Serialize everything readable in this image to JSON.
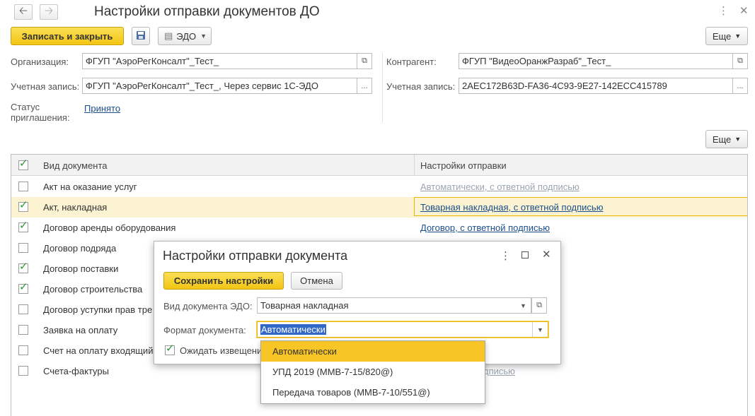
{
  "window": {
    "title": "Настройки отправки документов ДО"
  },
  "nav": {
    "back_icon": "arrow-left-icon",
    "forward_icon": "arrow-right-icon"
  },
  "toolbar": {
    "save_close": "Записать и закрыть",
    "edo": "ЭДО",
    "more": "Еще"
  },
  "form": {
    "org_label": "Организация:",
    "org_value": "ФГУП \"АэроРегКонсалт\"_Тест_",
    "account_label": "Учетная запись:",
    "account_value": "ФГУП \"АэроРегКонсалт\"_Тест_, Через сервис 1С-ЭДО",
    "status_label_1": "Статус",
    "status_label_2": "приглашения:",
    "status_value": "Принято",
    "counterparty_label": "Контрагент:",
    "counterparty_value": "ФГУП \"ВидеоОранжРазраб\"_Тест_",
    "cp_account_label": "Учетная запись:",
    "cp_account_value": "2AEC172B63D-FA36-4C93-9E27-142ECC415789"
  },
  "table_toolbar": {
    "more": "Еще"
  },
  "table": {
    "col_doc": "Вид документа",
    "col_settings": "Настройки отправки",
    "rows": [
      {
        "checked": false,
        "name": "Акт на оказание услуг",
        "settings": "Автоматически, с ответной подписью",
        "style": "gray"
      },
      {
        "checked": true,
        "name": "Акт, накладная",
        "settings": "Товарная накладная, с ответной подписью",
        "style": "link",
        "selected": true
      },
      {
        "checked": true,
        "name": "Договор аренды оборудования",
        "settings": "Договор, с ответной подписью",
        "style": "link"
      },
      {
        "checked": false,
        "name": "Договор подряда",
        "settings": "ью",
        "style": "gray"
      },
      {
        "checked": true,
        "name": "Договор поставки",
        "settings": "",
        "style": "gray"
      },
      {
        "checked": true,
        "name": "Договор строительства",
        "settings": "",
        "style": "gray"
      },
      {
        "checked": false,
        "name": "Договор уступки прав тре",
        "settings": "ью",
        "style": "gray"
      },
      {
        "checked": false,
        "name": "Заявка на оплату",
        "settings": "ью",
        "style": "gray"
      },
      {
        "checked": false,
        "name": "Счет на оплату входящий",
        "settings": "",
        "style": "gray"
      },
      {
        "checked": false,
        "name": "Счета-фактуры",
        "settings": ", с ответной подписью",
        "style": "gray"
      }
    ]
  },
  "dialog": {
    "title": "Настройки отправки документа",
    "save": "Сохранить настройки",
    "cancel": "Отмена",
    "doc_kind_label": "Вид документа ЭДО:",
    "doc_kind_value": "Товарная накладная",
    "format_label": "Формат документа:",
    "format_value": "Автоматически",
    "await_label": "Ожидать извещени"
  },
  "dropdown": {
    "options": [
      "Автоматически",
      "УПД 2019 (ММВ-7-15/820@)",
      "Передача товаров (ММВ-7-10/551@)"
    ]
  },
  "colors": {
    "accent_yellow": "#f3c514",
    "link": "#1a4f8b",
    "check": "#2a9a3a"
  }
}
